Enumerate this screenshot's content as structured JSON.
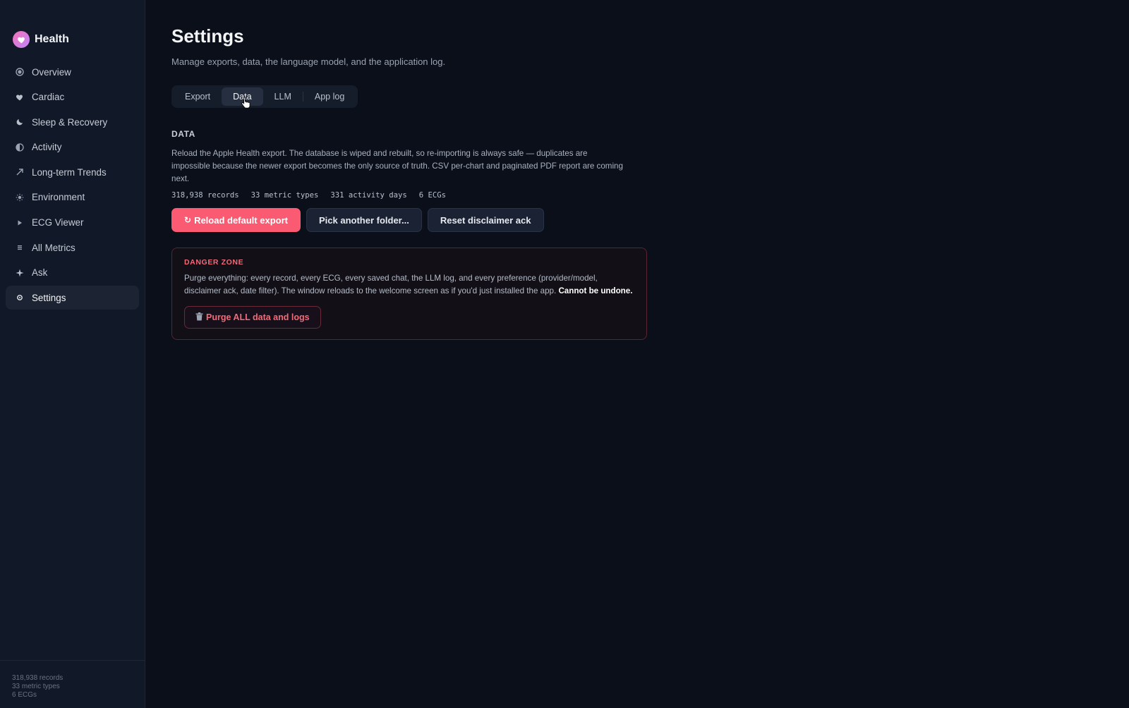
{
  "brand": {
    "name": "Health",
    "icon": "heart-icon",
    "accent": "#f472b6"
  },
  "sidebar": {
    "items": [
      {
        "label": "Overview",
        "icon": "overview-icon"
      },
      {
        "label": "Cardiac",
        "icon": "heart-icon"
      },
      {
        "label": "Sleep & Recovery",
        "icon": "moon-icon"
      },
      {
        "label": "Activity",
        "icon": "half-circle-icon"
      },
      {
        "label": "Long-term Trends",
        "icon": "trend-arrow-icon"
      },
      {
        "label": "Environment",
        "icon": "sun-icon"
      },
      {
        "label": "ECG Viewer",
        "icon": "play-icon"
      },
      {
        "label": "All Metrics",
        "icon": "list-icon"
      },
      {
        "label": "Ask",
        "icon": "sparkle-icon"
      },
      {
        "label": "Settings",
        "icon": "gear-icon",
        "active": true
      }
    ],
    "footer": {
      "records": "318,938 records",
      "metric_types": "33 metric types",
      "ecgs": "6 ECGs"
    }
  },
  "page": {
    "title": "Settings",
    "subtitle": "Manage exports, data, the language model, and the application log."
  },
  "tabs": [
    {
      "label": "Export"
    },
    {
      "label": "Data",
      "active": true
    },
    {
      "label": "LLM"
    },
    {
      "label": "App log"
    }
  ],
  "data_section": {
    "title": "DATA",
    "description": "Reload the Apple Health export. The database is wiped and rebuilt, so re-importing is always safe — duplicates are impossible because the newer export becomes the only source of truth. CSV per-chart and paginated PDF report are coming next.",
    "stats": [
      "318,938 records",
      "33 metric types",
      "331 activity days",
      "6 ECGs"
    ],
    "buttons": {
      "reload": "Reload default export",
      "pick": "Pick another folder...",
      "reset": "Reset disclaimer ack"
    }
  },
  "danger_zone": {
    "title": "DANGER ZONE",
    "description": "Purge everything: every record, every ECG, every saved chat, the LLM log, and every preference (provider/model, disclaimer ack, date filter). The window reloads to the welcome screen as if you'd just installed the app.",
    "warning": "Cannot be undone.",
    "button": "Purge ALL data and logs",
    "color": "#f26a7a"
  }
}
